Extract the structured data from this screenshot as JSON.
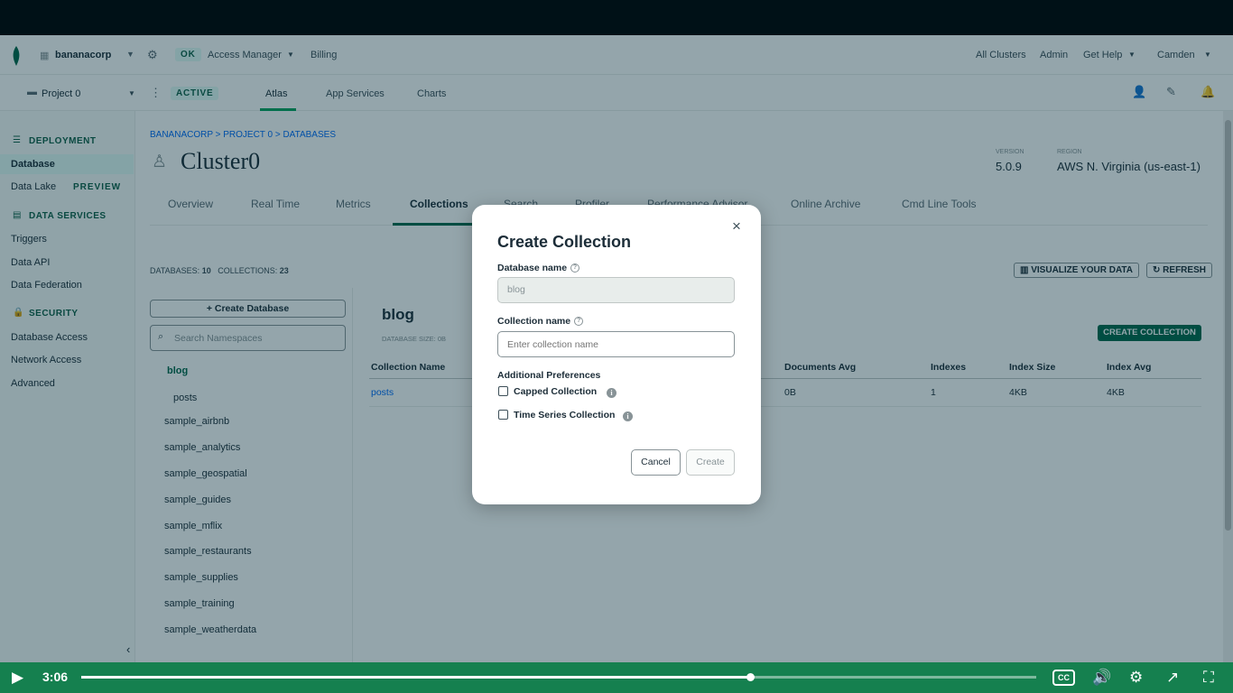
{
  "topbar": {
    "org_name": "bananacorp",
    "status_ok": "OK",
    "access_manager": "Access Manager",
    "billing": "Billing",
    "all_clusters": "All Clusters",
    "admin": "Admin",
    "get_help": "Get Help",
    "user": "Camden"
  },
  "projbar": {
    "project_name": "Project 0",
    "status": "ACTIVE",
    "tabs": [
      "Atlas",
      "App Services",
      "Charts"
    ]
  },
  "sidebar": {
    "deployment_header": "DEPLOYMENT",
    "database": "Database",
    "data_lake": "Data Lake",
    "preview_badge": "PREVIEW",
    "data_services_header": "DATA SERVICES",
    "triggers": "Triggers",
    "data_api": "Data API",
    "data_federation": "Data Federation",
    "security_header": "SECURITY",
    "database_access": "Database Access",
    "network_access": "Network Access",
    "advanced": "Advanced"
  },
  "main": {
    "breadcrumb": "BANANACORP > PROJECT 0 > DATABASES",
    "cluster_name": "Cluster0",
    "version_label": "VERSION",
    "version": "5.0.9",
    "region_label": "REGION",
    "region": "AWS N. Virginia (us-east-1)",
    "tabs": [
      "Overview",
      "Real Time",
      "Metrics",
      "Collections",
      "Search",
      "Profiler",
      "Performance Advisor",
      "Online Archive",
      "Cmd Line Tools"
    ],
    "databases_label": "DATABASES:",
    "databases_count": "10",
    "collections_label": "COLLECTIONS:",
    "collections_count": "23",
    "visualize_button": "VISUALIZE YOUR DATA",
    "refresh_button": "REFRESH",
    "create_database_button": "Create Database",
    "search_placeholder": "Search Namespaces",
    "db_list": [
      {
        "name": "blog",
        "collections": [
          "posts"
        ]
      },
      {
        "name": "sample_airbnb"
      },
      {
        "name": "sample_analytics"
      },
      {
        "name": "sample_geospatial"
      },
      {
        "name": "sample_guides"
      },
      {
        "name": "sample_mflix"
      },
      {
        "name": "sample_restaurants"
      },
      {
        "name": "sample_supplies"
      },
      {
        "name": "sample_training"
      },
      {
        "name": "sample_weatherdata"
      }
    ],
    "selected_db": "blog",
    "database_size_label": "DATABASE SIZE:",
    "database_size": "0B",
    "create_collection_button": "CREATE COLLECTION",
    "table_headers": [
      "Collection Name",
      "Documents Avg",
      "Indexes",
      "Index Size",
      "Index Avg"
    ],
    "table_rows": [
      [
        "posts",
        "0B",
        "1",
        "4KB",
        "4KB"
      ]
    ]
  },
  "modal": {
    "title": "Create Collection",
    "database_name_label": "Database name",
    "database_name_value": "blog",
    "collection_name_label": "Collection name",
    "collection_name_placeholder": "Enter collection name",
    "additional_prefs": "Additional Preferences",
    "capped_collection": "Capped Collection",
    "time_series_collection": "Time Series Collection",
    "cancel": "Cancel",
    "create": "Create",
    "close": "×"
  },
  "player": {
    "time": "3:06",
    "progress": 0.7,
    "colors": {
      "bar": "#15804f"
    }
  }
}
